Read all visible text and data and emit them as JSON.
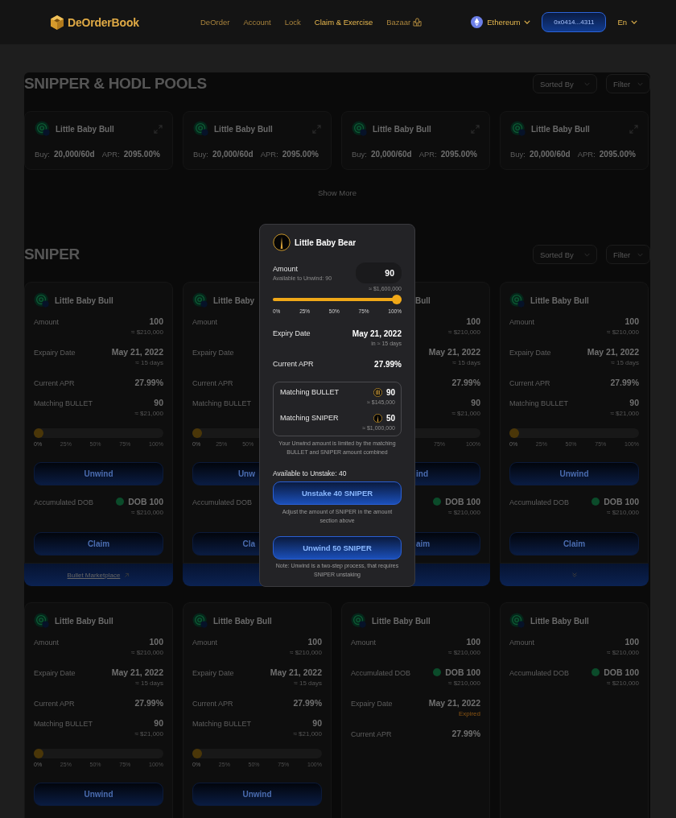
{
  "header": {
    "logo": "DeOrderBook",
    "nav": [
      {
        "label": "DeOrder",
        "selected": false
      },
      {
        "label": "Account",
        "selected": false
      },
      {
        "label": "Lock",
        "selected": false
      },
      {
        "label": "Claim & Exercise",
        "selected": true
      },
      {
        "label": "Bazaar",
        "selected": false
      }
    ],
    "network": "Ethereum",
    "wallet": "0x0414...4311",
    "language": "En"
  },
  "pools": {
    "title": "SNIPPER & HODL POOLS",
    "sort": "Sorted By",
    "filter": "Filter",
    "cards": [
      {
        "name": "Little Baby Bull",
        "buy_label": "Buy:",
        "buy": "20,000/60d",
        "apr_label": "APR:",
        "apr": "2095.00%"
      },
      {
        "name": "Little Baby Bull",
        "buy_label": "Buy:",
        "buy": "20,000/60d",
        "apr_label": "APR:",
        "apr": "2095.00%"
      },
      {
        "name": "Little Baby Bull",
        "buy_label": "Buy:",
        "buy": "20,000/60d",
        "apr_label": "APR:",
        "apr": "2095.00%"
      },
      {
        "name": "Little Baby Bull",
        "buy_label": "Buy:",
        "buy": "20,000/60d",
        "apr_label": "APR:",
        "apr": "2095.00%"
      }
    ],
    "show_more": "Show More"
  },
  "sniper": {
    "title": "SNIPER",
    "sort": "Sorted By",
    "filter": "Filter",
    "cards": [
      {
        "icon": true,
        "name": "Little Baby Bull",
        "rows": [
          {
            "kind": "stat",
            "label": "Amount",
            "value": "100",
            "sub": "≈ $210,000"
          },
          {
            "kind": "stat",
            "label": "Expairy Date",
            "value": "May 21, 2022",
            "sub": "≈ 15 days"
          },
          {
            "kind": "stat",
            "label": "Current APR",
            "value": "27.99%"
          },
          {
            "kind": "stat",
            "label": "Matching BULLET",
            "value": "90",
            "sub": "≈ $21,000"
          },
          {
            "kind": "slider",
            "level": 0,
            "ticks": [
              "0%",
              "25%",
              "50%",
              "75%",
              "100%"
            ]
          },
          {
            "kind": "button",
            "label": "Unwind"
          },
          {
            "kind": "dob",
            "label": "Accumulated DOB",
            "value": "DOB 100",
            "sub": "≈ $210,000",
            "color": "#0b4b2a"
          },
          {
            "kind": "button",
            "label": "Claim"
          }
        ],
        "footer": {
          "kind": "link",
          "label": "Bullet Marketplace"
        }
      },
      {
        "icon": true,
        "name": "Little Baby",
        "rows": [
          {
            "kind": "stat",
            "label": "Amount"
          },
          {
            "kind": "stat",
            "label": "Expairy Date"
          },
          {
            "kind": "stat",
            "label": "Current APR"
          },
          {
            "kind": "stat",
            "label": "Matching BULLET"
          },
          {
            "kind": "slider",
            "level": 0,
            "ticks": [
              "0%",
              "25%",
              "50%"
            ]
          },
          {
            "kind": "button",
            "label": "Unw"
          },
          {
            "kind": "dob",
            "label": "Accumulated DOB"
          },
          {
            "kind": "button",
            "label": "Cla"
          }
        ],
        "footer": {
          "kind": "plain"
        }
      },
      {
        "icon": false,
        "name": "Bull",
        "rows": [
          {
            "kind": "stat",
            "value": "100",
            "sub": "≈ $210,000"
          },
          {
            "kind": "stat",
            "value": "May 21, 2022",
            "sub": "≈ 15 days"
          },
          {
            "kind": "stat",
            "value": "27.99%"
          },
          {
            "kind": "stat",
            "value": "90",
            "sub": "≈ $21,000"
          },
          {
            "kind": "slider",
            "ticks": [
              "75%",
              "100%"
            ]
          },
          {
            "kind": "button",
            "label": "ind"
          },
          {
            "kind": "dob",
            "value": "DOB 100",
            "sub": "≈ $210,000",
            "color": "#0b4b2a"
          },
          {
            "kind": "button",
            "label": "aim"
          }
        ],
        "footer": {
          "kind": "plain"
        }
      },
      {
        "icon": true,
        "name": "Little Baby Bull",
        "rows": [
          {
            "kind": "stat",
            "label": "Amount",
            "value": "100",
            "sub": "≈ $210,000"
          },
          {
            "kind": "stat",
            "label": "Expairy Date",
            "value": "May 21, 2022",
            "sub": "≈ 15 days"
          },
          {
            "kind": "stat",
            "label": "Current APR",
            "value": "27.99%"
          },
          {
            "kind": "stat",
            "label": "Matching BULLET",
            "value": "90",
            "sub": "≈ $21,000"
          },
          {
            "kind": "slider",
            "level": 0,
            "ticks": [
              "0%",
              "25%",
              "50%",
              "75%",
              "100%"
            ]
          },
          {
            "kind": "button",
            "label": "Unwind"
          },
          {
            "kind": "dob",
            "label": "Accumulated DOB",
            "value": "DOB 100",
            "sub": "≈ $210,000",
            "color": "#0b4b2a"
          },
          {
            "kind": "button",
            "label": "Claim"
          }
        ],
        "footer": {
          "kind": "chevron"
        }
      }
    ]
  },
  "more_cards": [
    {
      "icon": true,
      "name": "Little Baby Bull",
      "rows": [
        {
          "kind": "stat",
          "label": "Amount",
          "value": "100",
          "sub": "≈ $210,000"
        },
        {
          "kind": "stat",
          "label": "Expairy Date",
          "value": "May 21, 2022",
          "sub": "≈ 15 days"
        },
        {
          "kind": "stat",
          "label": "Current APR",
          "value": "27.99%"
        },
        {
          "kind": "stat",
          "label": "Matching BULLET",
          "value": "90",
          "sub": "≈ $21,000"
        },
        {
          "kind": "slider",
          "level": 0,
          "ticks": [
            "0%",
            "25%",
            "50%",
            "75%",
            "100%"
          ]
        },
        {
          "kind": "button",
          "label": "Unwind"
        }
      ]
    },
    {
      "icon": true,
      "name": "Little Baby Bull",
      "rows": [
        {
          "kind": "stat",
          "label": "Amount",
          "value": "100",
          "sub": "≈ $210,000"
        },
        {
          "kind": "stat",
          "label": "Expairy Date",
          "value": "May 21, 2022",
          "sub": "≈ 15 days"
        },
        {
          "kind": "stat",
          "label": "Current APR",
          "value": "27.99%"
        },
        {
          "kind": "stat",
          "label": "Matching BULLET",
          "value": "90",
          "sub": "≈ $21,000"
        },
        {
          "kind": "slider",
          "level": 0,
          "ticks": [
            "0%",
            "25%",
            "50%",
            "75%",
            "100%"
          ]
        },
        {
          "kind": "button",
          "label": "Unwind"
        }
      ]
    },
    {
      "icon": true,
      "name": "Little Baby Bull",
      "rows": [
        {
          "kind": "stat",
          "label": "Amount",
          "value": "100",
          "sub": "≈ $210,000"
        },
        {
          "kind": "dob",
          "label": "Accumulated DOB",
          "value": "DOB 100",
          "sub": "≈ $210,000",
          "color": "#0b4b2a"
        },
        {
          "kind": "expired",
          "label": "Expairy Date",
          "value": "May 21, 2022",
          "sub": "Expired"
        },
        {
          "kind": "stat",
          "label": "Current APR",
          "value": "27.99%"
        }
      ]
    },
    {
      "icon": true,
      "name": "Little Baby Bull",
      "rows": [
        {
          "kind": "stat",
          "label": "Amount",
          "value": "100",
          "sub": "≈ $210,000"
        },
        {
          "kind": "dob",
          "label": "Accumulated DOB",
          "value": "DOB 100",
          "sub": "≈ $210,000",
          "color": "#0b4b2a"
        }
      ]
    }
  ],
  "modal": {
    "title": "Little Baby Bear",
    "amount_label": "Amount",
    "available": "Available to Unwind: 90",
    "input": "90",
    "input_usd": "≈ $1,600,000",
    "slider": {
      "level": 1,
      "ticks": [
        "0%",
        "25%",
        "50%",
        "75%",
        "100%"
      ]
    },
    "expiry_label": "Expiry Date",
    "expiry": "May 21, 2022",
    "expiry_sub": "in ≈ 15 days",
    "apr_label": "Current APR",
    "apr": "27.99%",
    "matching": [
      {
        "kind": "bullet",
        "label": "Matching BULLET",
        "value": "90",
        "sub": "≈ $145,000"
      },
      {
        "kind": "sniper",
        "label": "Matching SNIPER",
        "value": "50",
        "sub": "≈ $1,000,000"
      }
    ],
    "matching_note": "Your Unwind amount is limited by the matching BULLET and SNIPER amount combined",
    "unstake_available": "Available to Unstake: 40",
    "unstake_button": "Unstake 40 SNIPER",
    "unstake_hint": "Adjust the amount of SNIPER in the amount section above",
    "unwind_button": "Unwind 50 SNIPER",
    "unwind_note": "Note: Unwind is a two-step process, that requires SNIPER unstaking"
  }
}
